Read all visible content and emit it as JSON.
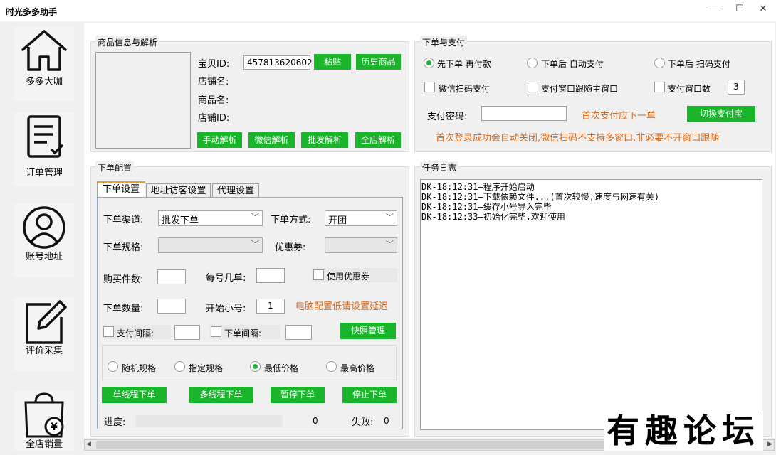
{
  "window": {
    "title": "时光多多助手",
    "minimize": "—",
    "maximize": "☐",
    "close": "✕"
  },
  "sidebar": {
    "items": [
      {
        "label": "多多大咖"
      },
      {
        "label": "订单管理"
      },
      {
        "label": "账号地址"
      },
      {
        "label": "评价采集"
      },
      {
        "label": "全店销量"
      }
    ]
  },
  "product": {
    "title": "商品信息与解析",
    "item_id_label": "宝贝ID:",
    "item_id_value": "457813620602",
    "paste_btn": "粘贴",
    "history_btn": "历史商品",
    "shop_name_label": "店铺名:",
    "product_name_label": "商品名:",
    "shop_id_label": "店铺ID:",
    "manual_btn": "手动解析",
    "wechat_btn": "微信解析",
    "batch_btn": "批发解析",
    "allshop_btn": "全店解析"
  },
  "payment": {
    "title": "下单与支付",
    "radio1": "先下单 再付款",
    "radio2": "下单后 自动支付",
    "radio3": "下单后 扫码支付",
    "check1": "微信扫码支付",
    "check2": "支付窗口跟随主窗口",
    "check3": "支付窗口数",
    "window_count": "3",
    "pwd_label": "支付密码:",
    "pwd_hint": "首次支付应下一单",
    "switch_btn": "切换支付宝",
    "notice": "首次登录成功会自动关闭,微信扫码不支持多窗口,非必要不开窗口跟随"
  },
  "config": {
    "title": "下单配置",
    "tabs": [
      "下单设置",
      "地址访客设置",
      "代理设置"
    ],
    "channel_label": "下单渠道:",
    "channel_value": "批发下单",
    "method_label": "下单方式:",
    "method_value": "开团",
    "spec_label": "下单规格:",
    "coupon_label": "优惠券:",
    "qty_label": "购买件数:",
    "per_label": "每号几单:",
    "use_coupon": "使用优惠券",
    "count_label": "下单数量:",
    "start_label": "开始小号:",
    "start_value": "1",
    "delay_hint": "电脑配置低请设置延迟",
    "pay_interval": "支付间隔:",
    "order_interval": "下单间隔:",
    "snapshot_btn": "快照管理",
    "r_random": "随机规格",
    "r_fixed": "指定规格",
    "r_lowest": "最低价格",
    "r_highest": "最高价格",
    "single_btn": "单线程下单",
    "multi_btn": "多线程下单",
    "pause_btn": "暂停下单",
    "stop_btn": "停止下单",
    "progress_label": "进度:",
    "progress_value": "0",
    "fail_label": "失败:",
    "fail_value": "0"
  },
  "log": {
    "title": "任务日志",
    "lines": [
      "DK-18:12:31—程序开始启动",
      "DK-18:12:31—下载依赖文件...(首次较慢,速度与网速有关)",
      "DK-18:12:31—缓存小号导入完毕",
      "DK-18:12:33—初始化完毕,欢迎使用"
    ]
  },
  "watermark": "有趣论坛"
}
